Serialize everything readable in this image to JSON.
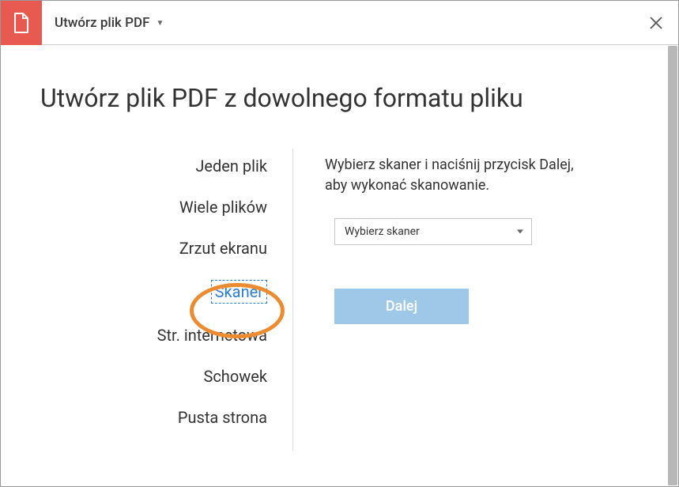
{
  "header": {
    "title": "Utwórz plik PDF"
  },
  "main": {
    "heading": "Utwórz plik PDF z dowolnego formatu pliku"
  },
  "options": [
    {
      "label": "Jeden plik",
      "selected": false
    },
    {
      "label": "Wiele plików",
      "selected": false
    },
    {
      "label": "Zrzut ekranu",
      "selected": false
    },
    {
      "label": "Skaner",
      "selected": true
    },
    {
      "label": "Str. internetowa",
      "selected": false
    },
    {
      "label": "Schowek",
      "selected": false
    },
    {
      "label": "Pusta strona",
      "selected": false
    }
  ],
  "detail": {
    "instruction": "Wybierz skaner i naciśnij przycisk Dalej, aby wykonać skanowanie.",
    "select_placeholder": "Wybierz skaner",
    "next_label": "Dalej"
  },
  "colors": {
    "accent_red": "#e85a4f",
    "highlight_orange": "#ec8b2f",
    "link_blue": "#2b7dd6",
    "button_blue": "#9ec7e8"
  }
}
